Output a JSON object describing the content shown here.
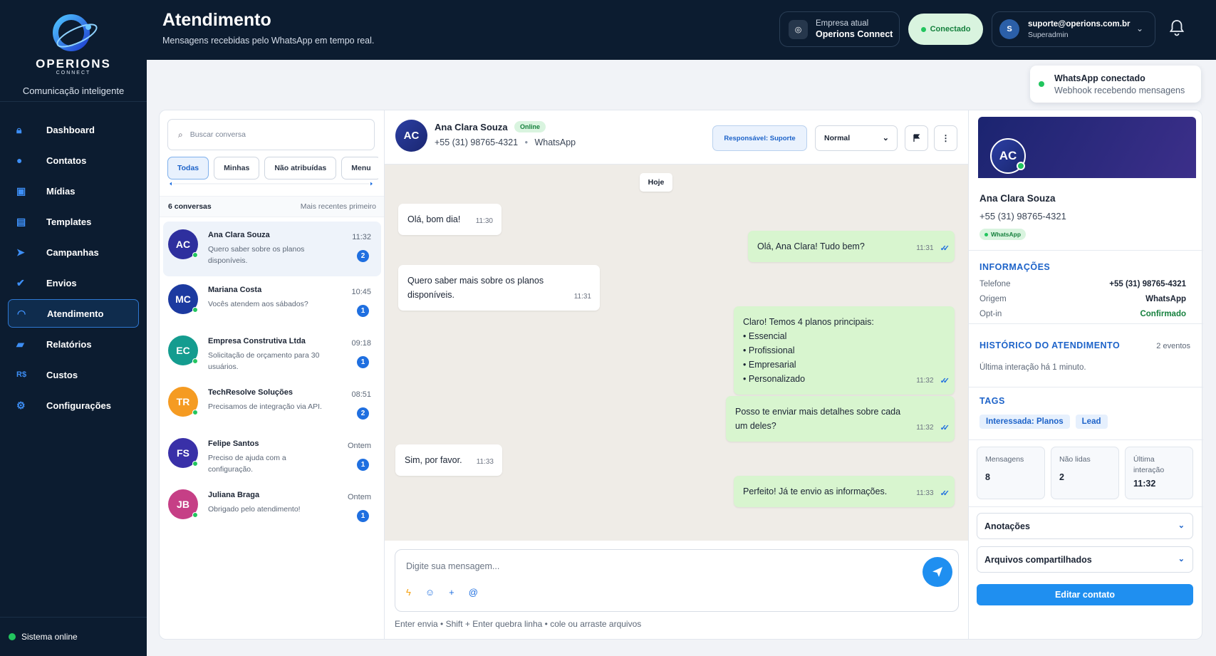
{
  "brand": {
    "name": "OPERIONS",
    "sub": "CONNECT",
    "tagline": "Comunicação inteligente"
  },
  "nav": [
    {
      "label": "Dashboard",
      "icon": "lock-icon"
    },
    {
      "label": "Contatos",
      "icon": "user-icon"
    },
    {
      "label": "Mídias",
      "icon": "image-icon"
    },
    {
      "label": "Templates",
      "icon": "document-icon"
    },
    {
      "label": "Campanhas",
      "icon": "send-icon"
    },
    {
      "label": "Envios",
      "icon": "check-icon"
    },
    {
      "label": "Atendimento",
      "icon": "headset-icon",
      "active": true
    },
    {
      "label": "Relatórios",
      "icon": "folder-icon"
    },
    {
      "label": "Custos",
      "icon": "currency-icon",
      "glyph": "R$"
    },
    {
      "label": "Configurações",
      "icon": "gear-icon"
    }
  ],
  "system_status": "Sistema online",
  "header": {
    "title": "Atendimento",
    "subtitle": "Mensagens recebidas pelo WhatsApp em tempo real.",
    "company_label": "Empresa atual",
    "company_name": "Operions Connect",
    "connection": "Conectado",
    "user_initial": "S",
    "user_email": "suporte@operions.com.br",
    "user_role": "Superadmin"
  },
  "toast": {
    "title": "WhatsApp conectado",
    "subtitle": "Webhook recebendo mensagens"
  },
  "list": {
    "search_placeholder": "Buscar conversa",
    "filters": [
      "Todas",
      "Minhas",
      "Não atribuídas",
      "Menu"
    ],
    "count": "6 conversas",
    "sort": "Mais recentes primeiro",
    "items": [
      {
        "initials": "AC",
        "name": "Ana Clara Souza",
        "preview": "Quero saber sobre os planos disponíveis.",
        "time": "11:32",
        "unread": "2",
        "color": "#2e2f9e",
        "selected": true
      },
      {
        "initials": "MC",
        "name": "Mariana Costa",
        "preview": "Vocês atendem aos sábados?",
        "time": "10:45",
        "unread": "1",
        "color": "#1c3aa0"
      },
      {
        "initials": "EC",
        "name": "Empresa Construtiva Ltda",
        "preview": "Solicitação de orçamento para 30 usuários.",
        "time": "09:18",
        "unread": "1",
        "color": "#149c8f"
      },
      {
        "initials": "TR",
        "name": "TechResolve Soluções",
        "preview": "Precisamos de integração via API.",
        "time": "08:51",
        "unread": "2",
        "color": "#f59b22"
      },
      {
        "initials": "FS",
        "name": "Felipe Santos",
        "preview": "Preciso de ajuda com a configuração.",
        "time": "Ontem",
        "unread": "1",
        "color": "#3930a8"
      },
      {
        "initials": "JB",
        "name": "Juliana Braga",
        "preview": "Obrigado pelo atendimento!",
        "time": "Ontem",
        "unread": "1",
        "color": "#c63f86"
      }
    ]
  },
  "chat": {
    "initials": "AC",
    "name": "Ana Clara Souza",
    "status": "Online",
    "phone": "+55 (31) 98765-4321",
    "channel": "WhatsApp",
    "responsible": "Responsável: Suporte",
    "priority": "Normal",
    "day": "Hoje",
    "placeholder": "Digite sua mensagem...",
    "hint": "Enter envia • Shift + Enter quebra linha • cole ou arraste arquivos",
    "messages": [
      {
        "dir": "in",
        "text": "Olá, bom dia!",
        "time": "11:30"
      },
      {
        "dir": "out",
        "text": "Olá, Ana Clara! Tudo bem?",
        "time": "11:31"
      },
      {
        "dir": "in",
        "text": "Quero saber mais sobre os planos disponíveis.",
        "time": "11:31"
      },
      {
        "dir": "out",
        "text": "Claro! Temos 4 planos principais:",
        "list": [
          "Essencial",
          "Profissional",
          "Empresarial",
          "Personalizado"
        ],
        "time": "11:32"
      },
      {
        "dir": "out",
        "text": "Posso te enviar mais detalhes sobre cada um deles?",
        "time": "11:32"
      },
      {
        "dir": "in",
        "text": "Sim, por favor.",
        "time": "11:33"
      },
      {
        "dir": "out",
        "text": "Perfeito! Já te envio as informações.",
        "time": "11:33"
      }
    ]
  },
  "contact": {
    "initials": "AC",
    "name": "Ana Clara Souza",
    "phone": "+55 (31) 98765-4321",
    "channel": "WhatsApp",
    "info_title": "INFORMAÇÕES",
    "info": [
      {
        "k": "Telefone",
        "v": "+55 (31) 98765-4321"
      },
      {
        "k": "Origem",
        "v": "WhatsApp"
      },
      {
        "k": "Opt-in",
        "v": "Confirmado",
        "color": "#15803d"
      }
    ],
    "history_title": "HISTÓRICO DO ATENDIMENTO",
    "history_count": "2 eventos",
    "history_text": "Última interação há 1 minuto.",
    "tags_title": "TAGS",
    "tags": [
      "Interessada: Planos",
      "Lead"
    ],
    "stats": [
      {
        "k": "Mensagens",
        "v": "8"
      },
      {
        "k": "Não lidas",
        "v": "2"
      },
      {
        "k": "Última interação",
        "v": "11:32"
      }
    ],
    "notes": "Anotações",
    "files": "Arquivos compartilhados",
    "edit": "Editar contato"
  },
  "colors": {
    "navy": "#0c1c30",
    "accent": "#1f6fe0",
    "green": "#22c55e",
    "bubble_out": "#d8f5cf"
  }
}
